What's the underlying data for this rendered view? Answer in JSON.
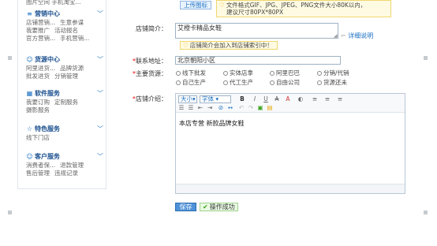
{
  "sidebar": {
    "top_row": "图片空间   手机淘宝...",
    "sections": [
      {
        "title": "营销中心",
        "icon": "≡",
        "rows": [
          [
            "店铺营销...",
            "生意参谋"
          ],
          [
            "我要推广",
            "活动报名"
          ],
          [
            "官方营销...",
            "手机营销..."
          ]
        ]
      },
      {
        "title": "货源中心",
        "icon": "☺",
        "rows": [
          [
            "阿里进货...",
            "品牌货源"
          ],
          [
            "批发进货",
            "分销管理"
          ]
        ]
      },
      {
        "title": "软件服务",
        "icon": "▦",
        "rows": [
          [
            "我要订购",
            "定制服务"
          ],
          [
            "摄影服务"
          ]
        ]
      },
      {
        "title": "特色服务",
        "icon": "☆",
        "rows": [
          [
            "线下门店"
          ]
        ]
      },
      {
        "title": "客户服务",
        "icon": "☺",
        "rows": [
          [
            "消费者保...",
            "退款管理"
          ],
          [
            "售后管理",
            "违规记录"
          ]
        ]
      }
    ]
  },
  "form": {
    "upload_label": "上传图标",
    "upload_tip_line1": "文件格式GIF、JPG、JPEG、PNG文件大小80K以内，",
    "upload_tip_line2": "建议尺寸80PX*80PX",
    "intro_label": "店铺简介：",
    "intro_value": "艾橙卡精品女鞋",
    "detail_link": "详细说明",
    "intro_tip": "店铺简介会加入到店铺索引中！",
    "address_label": "联系地址：",
    "address_value": "北京朝阳小区",
    "source_label": "主要货源：",
    "source_options": [
      "线下批发市场",
      "实体店拿货",
      "阿里巴巴批发",
      "分销/代销",
      "自己生产",
      "代工生产",
      "自由公司渠道",
      "货源还未确定"
    ],
    "source_row1": [
      "线下批发",
      "实体店拿",
      "阿里巴巴",
      "分销/代销"
    ],
    "source_row2": [
      "自己生产",
      "代工生产",
      "自由公司",
      "货源还未"
    ],
    "intro2_label": "店铺介绍：",
    "editor_size": "大小",
    "editor_font": "字体",
    "editor_content": "本店专营  新款品牌女鞋",
    "save_label": "保存",
    "success_msg": "操作成功"
  }
}
